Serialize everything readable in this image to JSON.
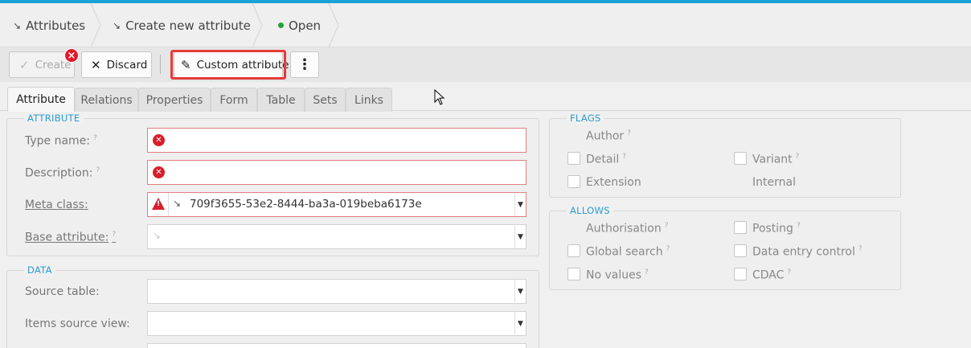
{
  "breadcrumb": {
    "items": [
      {
        "icon": "attribute-icon",
        "label": "Attributes"
      },
      {
        "icon": "attribute-icon",
        "label": "Create new attribute"
      },
      {
        "icon": "status-dot",
        "label": "Open",
        "color": "#23a33a"
      }
    ]
  },
  "toolbar": {
    "create_label": "Create",
    "discard_label": "Discard",
    "custom_attribute_label": "Custom attribute",
    "error_badge": "×",
    "more_icon": "⋮"
  },
  "tabs": [
    {
      "label": "Attribute",
      "active": true
    },
    {
      "label": "Relations"
    },
    {
      "label": "Properties"
    },
    {
      "label": "Form"
    },
    {
      "label": "Table"
    },
    {
      "label": "Sets"
    },
    {
      "label": "Links"
    }
  ],
  "attribute_section": {
    "legend": "ATTRIBUTE",
    "type_name": {
      "label": "Type name:",
      "hint": "?",
      "value": ""
    },
    "description": {
      "label": "Description:",
      "hint": "?",
      "value": ""
    },
    "meta_class": {
      "label": "Meta class:",
      "value": "709f3655-53e2-8444-ba3a-019beba6173e"
    },
    "base_attribute": {
      "label": "Base attribute:",
      "hint": "?",
      "value": ""
    }
  },
  "data_section": {
    "legend": "DATA",
    "source_table": {
      "label": "Source table:",
      "value": ""
    },
    "items_source_view": {
      "label": "Items source view:",
      "value": ""
    }
  },
  "flags": {
    "legend": "FLAGS",
    "author": {
      "label": "Author",
      "hint": "?"
    },
    "detail": {
      "label": "Detail",
      "hint": "?",
      "checked": false
    },
    "variant": {
      "label": "Variant",
      "hint": "?",
      "checked": false
    },
    "extension": {
      "label": "Extension",
      "checked": false
    },
    "internal": {
      "label": "Internal"
    }
  },
  "allows": {
    "legend": "ALLOWS",
    "authorisation": {
      "label": "Authorisation",
      "hint": "?"
    },
    "posting": {
      "label": "Posting",
      "hint": "?",
      "checked": false
    },
    "global_search": {
      "label": "Global search",
      "hint": "?",
      "checked": false
    },
    "data_entry_control": {
      "label": "Data entry control",
      "hint": "?",
      "checked": false
    },
    "no_values": {
      "label": "No values",
      "hint": "?",
      "checked": false
    },
    "cdac": {
      "label": "CDAC",
      "hint": "?",
      "checked": false
    }
  },
  "colors": {
    "accent": "#1aa3d8",
    "error": "#d81f2b",
    "highlight": "#e53b3b",
    "status_open": "#23a33a"
  }
}
